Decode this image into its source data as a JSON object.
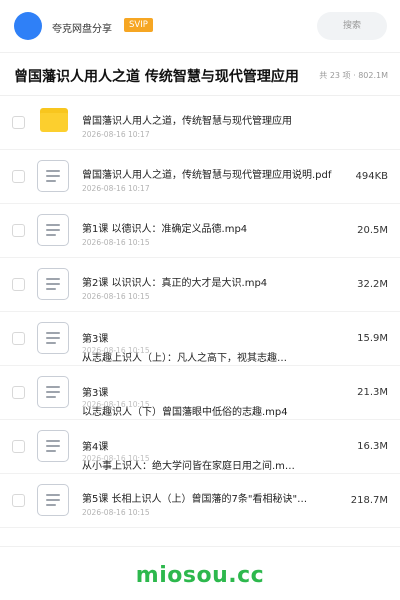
{
  "header": {
    "app_name": "夸克网盘分享",
    "badge": "SVIP",
    "search_placeholder": "搜索"
  },
  "page": {
    "title": "曾国藩识人用人之道 传统智慧与现代管理应用",
    "meta": "共 23 项 · 802.1M"
  },
  "files": [
    {
      "type": "folder",
      "name": "曾国藩识人用人之道，传统智慧与现代管理应用",
      "date": "2026-08-16 10:17",
      "size": ""
    },
    {
      "type": "file",
      "name": "曾国藩识人用人之道，传统智慧与现代管理应用说明.pdf",
      "date": "2026-08-16 10:17",
      "size": "494KB"
    },
    {
      "type": "file",
      "name": "第1课 以德识人：准确定义品德.mp4",
      "date": "2026-08-16 10:15",
      "size": "20.5M"
    },
    {
      "type": "file",
      "name": "第2课 以识识人：真正的大才是大识.mp4",
      "date": "2026-08-16 10:15",
      "size": "32.2M"
    },
    {
      "type": "file2",
      "name_line1": "第3课",
      "name_line2": "从志趣上识人（上）：凡人之高下，视其志趣…",
      "date": "2026-08-16 10:15",
      "size": "15.9M"
    },
    {
      "type": "file2",
      "name_line1": "第3课",
      "name_line2": "以志趣识人（下）曾国藩眼中低俗的志趣.mp4",
      "date": "2026-08-16 10:15",
      "size": "21.3M"
    },
    {
      "type": "file2",
      "name_line1": "第4课",
      "name_line2": "从小事上识人：绝大学问皆在家庭日用之间.m…",
      "date": "2026-08-16 10:15",
      "size": "16.3M"
    },
    {
      "type": "file",
      "name": "第5课 长相上识人（上）曾国藩的7条\"看相秘诀\"…",
      "date": "2026-08-16 10:15",
      "size": "218.7M"
    }
  ],
  "watermark": "miosou.cc",
  "colors": {
    "avatar": "#2f80f7",
    "svip_badge": "#f6a623",
    "folder": "#fccf2e",
    "watermark": "#2db84d"
  },
  "icons": {
    "folder": "folder-icon",
    "file": "document-icon"
  }
}
